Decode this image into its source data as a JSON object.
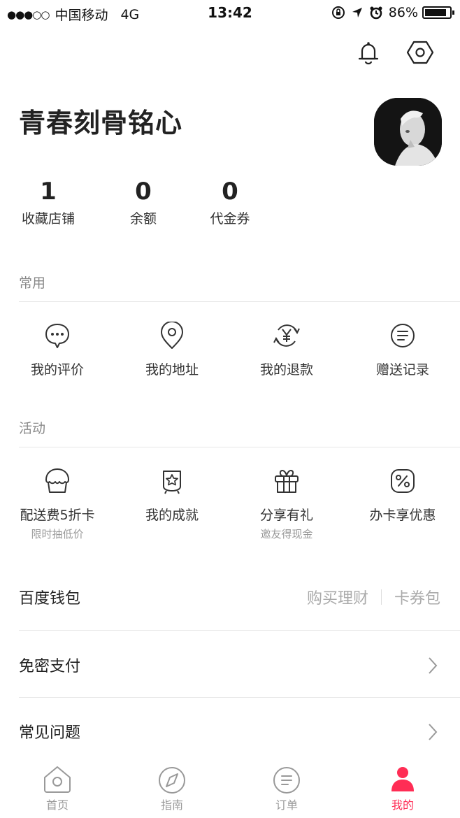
{
  "status_bar": {
    "signal": "●●●○○",
    "carrier": "中国移动",
    "network": "4G",
    "time": "13:42",
    "battery": "86%"
  },
  "profile": {
    "username": "青春刻骨铭心"
  },
  "stats": [
    {
      "value": "1",
      "label": "收藏店铺"
    },
    {
      "value": "0",
      "label": "余额"
    },
    {
      "value": "0",
      "label": "代金券"
    }
  ],
  "common": {
    "title": "常用",
    "items": [
      {
        "label": "我的评价",
        "icon": "chat-bubble-icon"
      },
      {
        "label": "我的地址",
        "icon": "location-pin-icon"
      },
      {
        "label": "我的退款",
        "icon": "refund-icon"
      },
      {
        "label": "赠送记录",
        "icon": "list-icon"
      }
    ]
  },
  "activity": {
    "title": "活动",
    "items": [
      {
        "label": "配送费5折卡",
        "sub": "限时抽低价",
        "icon": "cupcake-icon"
      },
      {
        "label": "我的成就",
        "sub": "",
        "icon": "badge-icon"
      },
      {
        "label": "分享有礼",
        "sub": "邀友得现金",
        "icon": "gift-icon"
      },
      {
        "label": "办卡享优惠",
        "sub": "",
        "icon": "percent-icon"
      }
    ]
  },
  "wallet": {
    "label": "百度钱包",
    "link1": "购买理财",
    "link2": "卡券包"
  },
  "rows": [
    {
      "label": "免密支付"
    },
    {
      "label": "常见问题"
    }
  ],
  "tabs": [
    {
      "label": "首页",
      "icon": "home-icon"
    },
    {
      "label": "指南",
      "icon": "compass-icon"
    },
    {
      "label": "订单",
      "icon": "order-icon"
    },
    {
      "label": "我的",
      "icon": "user-icon"
    }
  ],
  "colors": {
    "accent": "#ff2d55",
    "text": "#222222",
    "muted": "#999999"
  }
}
